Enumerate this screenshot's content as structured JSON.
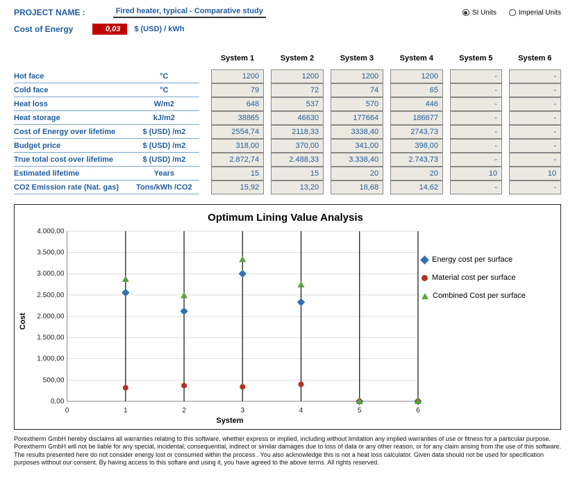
{
  "header": {
    "project_label": "PROJECT NAME :",
    "project_value": "Fired heater, typical - Comparative study",
    "units": {
      "si": "SI Units",
      "imperial": "Imperial Units",
      "selected": "si"
    }
  },
  "cost_energy": {
    "label": "Cost of Energy",
    "value": "0,03",
    "unit": "$ (USD) / kWh"
  },
  "systems": [
    "System 1",
    "System 2",
    "System 3",
    "System 4",
    "System 5",
    "System 6"
  ],
  "rows": [
    {
      "label": "Hot face",
      "unit": "°C",
      "v": [
        "1200",
        "1200",
        "1200",
        "1200",
        "-",
        "-"
      ]
    },
    {
      "label": "Cold face",
      "unit": "°C",
      "v": [
        "79",
        "72",
        "74",
        "65",
        "-",
        "-"
      ]
    },
    {
      "label": "Heat loss",
      "unit": "W/m2",
      "v": [
        "648",
        "537",
        "570",
        "446",
        "-",
        "-"
      ]
    },
    {
      "label": "Heat storage",
      "unit": "kJ/m2",
      "v": [
        "38865",
        "46630",
        "177664",
        "186677",
        "-",
        "-"
      ]
    },
    {
      "label": "Cost of Energy over lifetime",
      "unit": "$ (USD)  /m2",
      "v": [
        "2554,74",
        "2118,33",
        "3338,40",
        "2743,73",
        "-",
        "-"
      ]
    },
    {
      "label": "Budget price",
      "unit": "$ (USD)  /m2",
      "v": [
        "318,00",
        "370,00",
        "341,00",
        "398,00",
        "-",
        "-"
      ]
    },
    {
      "label": "True total cost over lifetime",
      "unit": "$ (USD)  /m2",
      "v": [
        "2.872,74",
        "2.488,33",
        "3.338,40",
        "2.743,73",
        "-",
        "-"
      ]
    },
    {
      "label": "Estimated lifetime",
      "unit": "Years",
      "v": [
        "15",
        "15",
        "20",
        "20",
        "10",
        "10"
      ]
    },
    {
      "label": "CO2 Emission rate (Nat. gas)",
      "unit": "Tons/kWh    /CO2",
      "v": [
        "15,92",
        "13,20",
        "18,68",
        "14,62",
        "-",
        "-"
      ]
    }
  ],
  "chart_data": {
    "type": "scatter",
    "title": "Optimum Lining Value Analysis",
    "xlabel": "System",
    "ylabel": "Cost",
    "x": [
      0,
      1,
      2,
      3,
      4,
      5,
      6
    ],
    "ylim": [
      0,
      4000
    ],
    "yticks": [
      "0,00",
      "500,00",
      "1.000,00",
      "1.500,00",
      "2.000,00",
      "2.500,00",
      "3.000,00",
      "3.500,00",
      "4.000,00"
    ],
    "series": [
      {
        "name": "Energy cost per surface",
        "marker": "diamond",
        "color": "#2f6fb7",
        "points": [
          [
            1,
            2554.74
          ],
          [
            2,
            2118.33
          ],
          [
            3,
            3000.0
          ],
          [
            4,
            2330.0
          ],
          [
            5,
            0
          ],
          [
            6,
            0
          ]
        ]
      },
      {
        "name": "Material cost per surface",
        "marker": "circle",
        "color": "#b33322",
        "points": [
          [
            1,
            318.0
          ],
          [
            2,
            370.0
          ],
          [
            3,
            341.0
          ],
          [
            4,
            398.0
          ],
          [
            5,
            0
          ],
          [
            6,
            0
          ]
        ]
      },
      {
        "name": "Combined Cost per surface",
        "marker": "triangle",
        "color": "#5aa43a",
        "points": [
          [
            1,
            2872.74
          ],
          [
            2,
            2488.33
          ],
          [
            3,
            3338.4
          ],
          [
            4,
            2743.73
          ],
          [
            5,
            0
          ],
          [
            6,
            0
          ]
        ]
      }
    ],
    "vlines_x": [
      1,
      2,
      3,
      4,
      5,
      6
    ]
  },
  "disclaimer": "Porextherm GmbH hereby disclaims all warranties relating to this software, whether express or implied, including without limitation any implied warranties of use or fitness for a particular purpose. Porextherm GmbH will not be liable for any special, incidental, consequential, indirect or similar damages due to loss of data or any other reason, or for any claim arising from the use of this software. The results presented here do not consider energy lost or consumed within the process .  You also acknowledge this is not a heat loss calculator.  Given data should not be used for specification purposes without our consent.  By having access to this softare and using it, you have agreed to the above terms. All rights reserved."
}
